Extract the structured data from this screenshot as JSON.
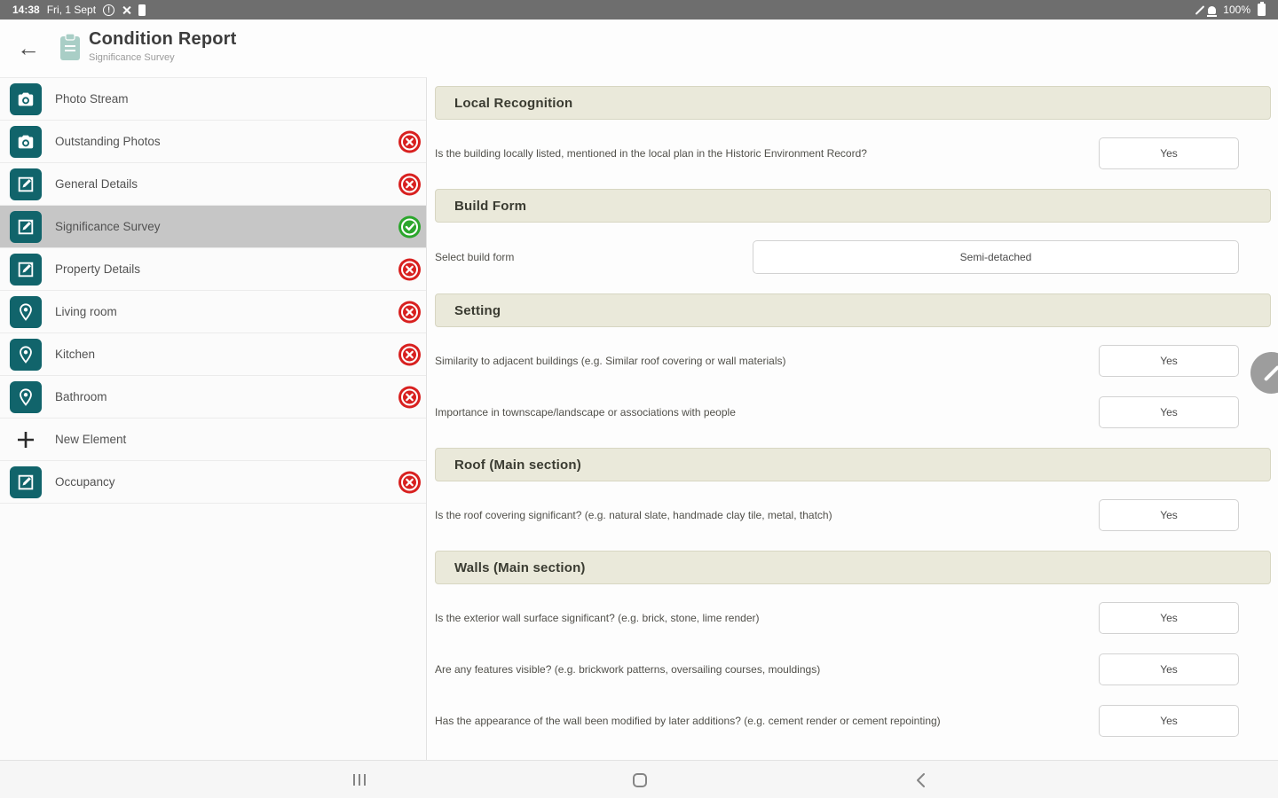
{
  "status_bar": {
    "time": "14:38",
    "date": "Fri, 1 Sept",
    "battery_percent": "100%",
    "left_icons": [
      "alert-circle-icon",
      "cross-icon",
      "sim-icon"
    ],
    "right_icons": [
      "pen-icon",
      "mute-icon",
      "battery-icon"
    ]
  },
  "header": {
    "title": "Condition Report",
    "subtitle": "Significance Survey",
    "back_icon": "arrow-left-icon",
    "doc_icon": "clipboard-icon"
  },
  "sidebar": {
    "items": [
      {
        "label": "Photo Stream",
        "icon": "camera",
        "badge": "none",
        "selected": false
      },
      {
        "label": "Outstanding Photos",
        "icon": "camera",
        "badge": "error",
        "selected": false
      },
      {
        "label": "General Details",
        "icon": "edit",
        "badge": "error",
        "selected": false
      },
      {
        "label": "Significance Survey",
        "icon": "edit",
        "badge": "complete",
        "selected": true
      },
      {
        "label": "Property Details",
        "icon": "edit",
        "badge": "error",
        "selected": false
      },
      {
        "label": "Living room",
        "icon": "pin",
        "badge": "error",
        "selected": false
      },
      {
        "label": "Kitchen",
        "icon": "pin",
        "badge": "error",
        "selected": false
      },
      {
        "label": "Bathroom",
        "icon": "pin",
        "badge": "error",
        "selected": false
      },
      {
        "label": "New Element",
        "icon": "plus",
        "badge": "none",
        "selected": false
      },
      {
        "label": "Occupancy",
        "icon": "edit",
        "badge": "error",
        "selected": false
      }
    ]
  },
  "main": {
    "sections": [
      {
        "title": "Local Recognition",
        "rows": [
          {
            "type": "question",
            "label": "Is the building locally listed, mentioned in the local plan in the Historic Environment Record?",
            "answer": "Yes"
          }
        ]
      },
      {
        "title": "Build Form",
        "rows": [
          {
            "type": "select",
            "label": "Select build form",
            "value": "Semi-detached"
          }
        ]
      },
      {
        "title": "Setting",
        "rows": [
          {
            "type": "question",
            "label": "Similarity to adjacent buildings (e.g. Similar roof covering or wall materials)",
            "answer": "Yes"
          },
          {
            "type": "question",
            "label": "Importance in townscape/landscape or associations with people",
            "answer": "Yes"
          }
        ]
      },
      {
        "title": "Roof (Main section)",
        "rows": [
          {
            "type": "question",
            "label": "Is the roof covering significant? (e.g. natural slate, handmade clay tile, metal, thatch)",
            "answer": "Yes"
          }
        ]
      },
      {
        "title": "Walls (Main section)",
        "rows": [
          {
            "type": "question",
            "label": "Is the exterior wall surface significant? (e.g. brick, stone, lime render)",
            "answer": "Yes"
          },
          {
            "type": "question",
            "label": "Are any features visible? (e.g. brickwork patterns, oversailing courses, mouldings)",
            "answer": "Yes"
          },
          {
            "type": "question",
            "label": "Has the appearance of the wall been modified by later additions? (e.g. cement render or cement repointing)",
            "answer": "Yes"
          }
        ]
      }
    ]
  },
  "floating_edit_button": {
    "icon": "pencil-icon"
  },
  "nav_bar": {
    "buttons": [
      "recents",
      "home",
      "back"
    ]
  },
  "colors": {
    "accent_teal": "#11646b",
    "section_header_bg": "#eae9da",
    "section_header_border": "#d7d6c2",
    "error_red": "#d8201f",
    "success_green": "#2ba62c",
    "selected_row": "#c6c6c6",
    "status_bar_bg": "#6e6e6e"
  }
}
